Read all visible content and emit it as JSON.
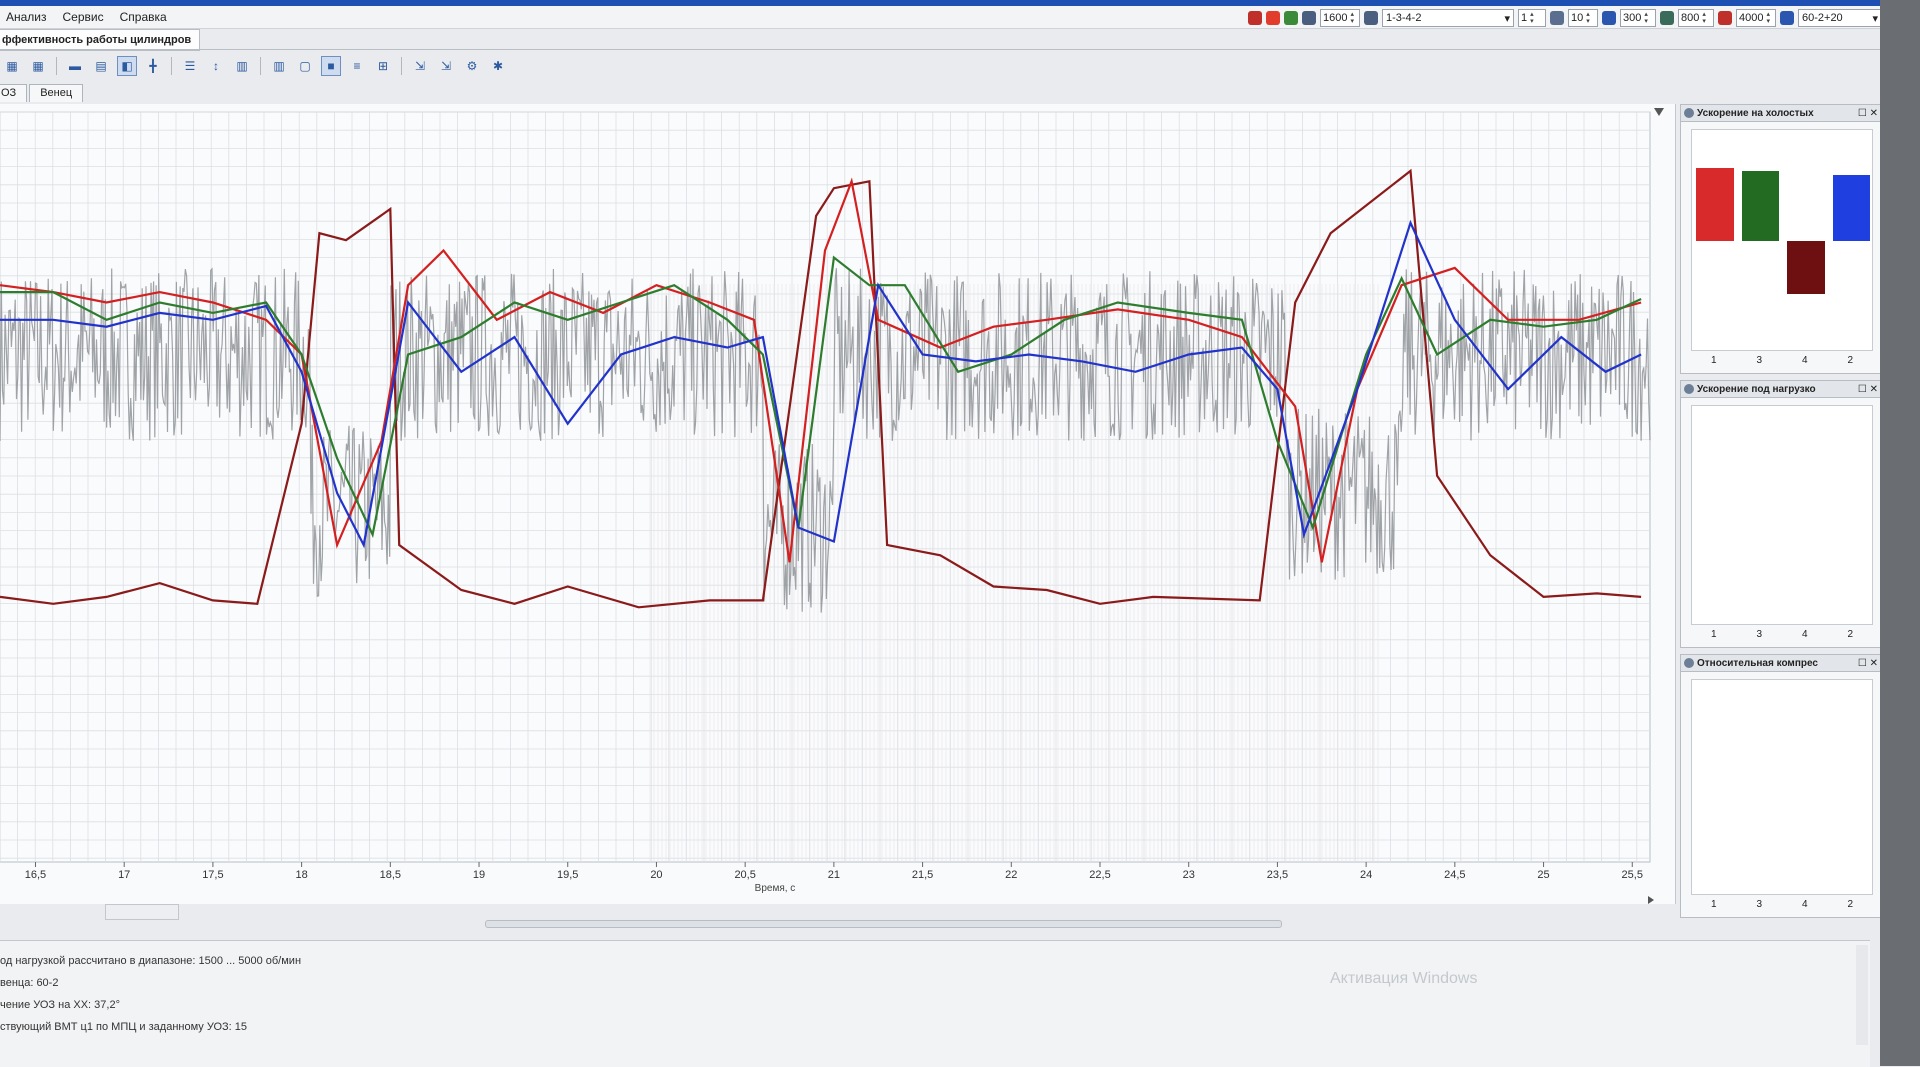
{
  "menu": [
    "Анализ",
    "Сервис",
    "Справка"
  ],
  "params": {
    "rpm": "1600",
    "firing_order": "1-3-4-2",
    "cylinder": "1",
    "value_10": "10",
    "value_300": "300",
    "value_800": "800",
    "value_4000": "4000",
    "wheel": "60-2+20"
  },
  "doc_tab": "ффективность работы цилиндров",
  "subtabs": [
    "ОЗ",
    "Венец"
  ],
  "toolbar_icons": [
    "cyl-icon",
    "cyl-icon",
    "bar-icon",
    "grid-icon",
    "chart-icon",
    "split-icon",
    "list-icon",
    "height-icon",
    "bars-icon",
    "bars-icon",
    "frame-icon",
    "fill-icon",
    "lines-icon",
    "tree-icon",
    "export-icon",
    "export-icon",
    "settings-icon",
    "bug-icon"
  ],
  "chart_data": {
    "type": "line",
    "xlabel": "Время, с",
    "x_ticks": [
      "16,5",
      "17",
      "17,5",
      "18",
      "18,5",
      "19",
      "19,5",
      "20",
      "20,5",
      "21",
      "21,5",
      "22",
      "22,5",
      "23",
      "23,5",
      "24",
      "24,5",
      "25",
      "25,5"
    ],
    "xlim": [
      16.3,
      25.6
    ],
    "grid": true,
    "series": [
      {
        "color": "#8b1a1a",
        "points": [
          [
            16.3,
            80
          ],
          [
            16.6,
            78
          ],
          [
            16.9,
            80
          ],
          [
            17.2,
            84
          ],
          [
            17.5,
            79
          ],
          [
            17.75,
            78
          ],
          [
            18.0,
            130
          ],
          [
            18.1,
            185
          ],
          [
            18.25,
            183
          ],
          [
            18.5,
            192
          ],
          [
            18.55,
            95
          ],
          [
            18.9,
            82
          ],
          [
            19.2,
            78
          ],
          [
            19.5,
            83
          ],
          [
            19.9,
            77
          ],
          [
            20.3,
            79
          ],
          [
            20.6,
            79
          ],
          [
            20.9,
            190
          ],
          [
            21.0,
            198
          ],
          [
            21.2,
            200
          ],
          [
            21.3,
            95
          ],
          [
            21.6,
            92
          ],
          [
            21.9,
            83
          ],
          [
            22.2,
            82
          ],
          [
            22.5,
            78
          ],
          [
            22.8,
            80
          ],
          [
            23.4,
            79
          ],
          [
            23.6,
            165
          ],
          [
            23.8,
            185
          ],
          [
            24.25,
            203
          ],
          [
            24.4,
            115
          ],
          [
            24.7,
            92
          ],
          [
            25.0,
            80
          ],
          [
            25.3,
            81
          ],
          [
            25.55,
            80
          ]
        ]
      },
      {
        "color": "#d42020",
        "points": [
          [
            16.3,
            170
          ],
          [
            16.6,
            168
          ],
          [
            16.9,
            165
          ],
          [
            17.2,
            168
          ],
          [
            17.5,
            165
          ],
          [
            17.8,
            160
          ],
          [
            18.0,
            150
          ],
          [
            18.2,
            95
          ],
          [
            18.45,
            125
          ],
          [
            18.6,
            170
          ],
          [
            18.8,
            180
          ],
          [
            19.1,
            160
          ],
          [
            19.4,
            168
          ],
          [
            19.7,
            162
          ],
          [
            20.0,
            170
          ],
          [
            20.3,
            165
          ],
          [
            20.55,
            160
          ],
          [
            20.75,
            90
          ],
          [
            20.95,
            180
          ],
          [
            21.1,
            200
          ],
          [
            21.25,
            160
          ],
          [
            21.6,
            152
          ],
          [
            21.9,
            158
          ],
          [
            22.2,
            160
          ],
          [
            22.6,
            163
          ],
          [
            23.0,
            160
          ],
          [
            23.3,
            155
          ],
          [
            23.6,
            135
          ],
          [
            23.75,
            90
          ],
          [
            23.95,
            140
          ],
          [
            24.2,
            170
          ],
          [
            24.5,
            175
          ],
          [
            24.8,
            160
          ],
          [
            25.2,
            160
          ],
          [
            25.55,
            165
          ]
        ]
      },
      {
        "color": "#2e7d2e",
        "points": [
          [
            16.3,
            168
          ],
          [
            16.6,
            168
          ],
          [
            16.9,
            160
          ],
          [
            17.2,
            165
          ],
          [
            17.5,
            162
          ],
          [
            17.8,
            165
          ],
          [
            18.0,
            150
          ],
          [
            18.2,
            120
          ],
          [
            18.4,
            98
          ],
          [
            18.6,
            150
          ],
          [
            18.9,
            155
          ],
          [
            19.2,
            165
          ],
          [
            19.5,
            160
          ],
          [
            19.8,
            165
          ],
          [
            20.1,
            170
          ],
          [
            20.4,
            160
          ],
          [
            20.6,
            150
          ],
          [
            20.8,
            100
          ],
          [
            21.0,
            178
          ],
          [
            21.2,
            170
          ],
          [
            21.4,
            170
          ],
          [
            21.7,
            145
          ],
          [
            22.0,
            150
          ],
          [
            22.3,
            160
          ],
          [
            22.6,
            165
          ],
          [
            23.0,
            162
          ],
          [
            23.3,
            160
          ],
          [
            23.5,
            125
          ],
          [
            23.7,
            100
          ],
          [
            24.0,
            150
          ],
          [
            24.2,
            172
          ],
          [
            24.4,
            150
          ],
          [
            24.7,
            160
          ],
          [
            25.0,
            158
          ],
          [
            25.3,
            160
          ],
          [
            25.55,
            166
          ]
        ]
      },
      {
        "color": "#2233cc",
        "points": [
          [
            16.3,
            160
          ],
          [
            16.6,
            160
          ],
          [
            16.9,
            158
          ],
          [
            17.2,
            162
          ],
          [
            17.5,
            160
          ],
          [
            17.8,
            164
          ],
          [
            18.0,
            145
          ],
          [
            18.2,
            110
          ],
          [
            18.35,
            95
          ],
          [
            18.6,
            165
          ],
          [
            18.9,
            145
          ],
          [
            19.2,
            155
          ],
          [
            19.5,
            130
          ],
          [
            19.8,
            150
          ],
          [
            20.1,
            155
          ],
          [
            20.4,
            152
          ],
          [
            20.6,
            155
          ],
          [
            20.8,
            100
          ],
          [
            21.0,
            96
          ],
          [
            21.25,
            170
          ],
          [
            21.5,
            150
          ],
          [
            21.8,
            148
          ],
          [
            22.1,
            150
          ],
          [
            22.4,
            148
          ],
          [
            22.7,
            145
          ],
          [
            23.0,
            150
          ],
          [
            23.3,
            152
          ],
          [
            23.5,
            140
          ],
          [
            23.65,
            98
          ],
          [
            23.95,
            140
          ],
          [
            24.25,
            188
          ],
          [
            24.5,
            160
          ],
          [
            24.8,
            140
          ],
          [
            25.1,
            155
          ],
          [
            25.35,
            145
          ],
          [
            25.55,
            150
          ]
        ]
      }
    ]
  },
  "mini_panels": [
    {
      "title": "Ускорение на холостых",
      "ticks": [
        "1",
        "3",
        "4",
        "2"
      ],
      "bars": [
        {
          "value": 1.0,
          "color": "#d82a2a"
        },
        {
          "value": 0.95,
          "color": "#236b23"
        },
        {
          "value": -0.72,
          "color": "#6e0f12"
        },
        {
          "value": 0.9,
          "color": "#1f3fe0"
        }
      ]
    },
    {
      "title": "Ускорение под нагрузко",
      "ticks": [
        "1",
        "3",
        "4",
        "2"
      ],
      "bars": []
    },
    {
      "title": "Относительная компрес",
      "ticks": [
        "1",
        "3",
        "4",
        "2"
      ],
      "bars": []
    }
  ],
  "log": [
    "од нагрузкой рассчитано в диапазоне: 1500 ... 5000 об/мин",
    "венца: 60-2",
    "чение УОЗ на ХХ: 37,2°",
    "ствующий ВМТ ц1 по МПЦ и заданному УОЗ: 15"
  ],
  "watermark": "Активация Windows"
}
